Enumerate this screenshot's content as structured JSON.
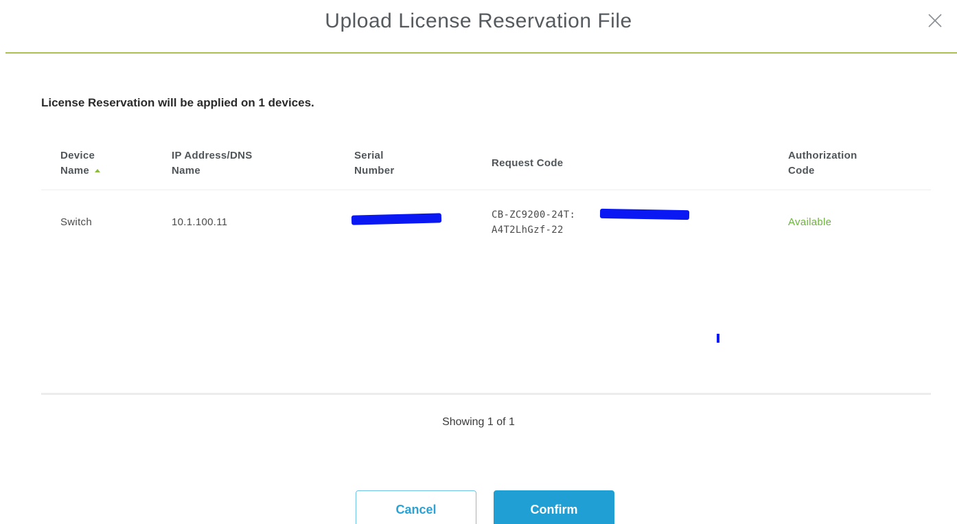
{
  "dialog": {
    "title": "Upload License Reservation File",
    "summary": "License Reservation will be applied on 1 devices."
  },
  "table": {
    "columns": {
      "device_name": [
        "Device",
        "Name"
      ],
      "ip_address": [
        "IP Address/DNS",
        "Name"
      ],
      "serial_number": [
        "Serial",
        "Number"
      ],
      "request_code": "Request Code",
      "authorization_code": [
        "Authorization",
        "Code"
      ]
    },
    "sorted_column": "Device Name",
    "sort_direction": "ascending",
    "rows": [
      {
        "device_name": "Switch",
        "ip_address": "10.1.100.11",
        "serial_number": "",
        "request_code_line1": "CB-ZC9200-24T:",
        "request_code_line2": "A4T2LhGzf-22",
        "authorization_code": "Available"
      }
    ]
  },
  "pagination": {
    "text": "Showing 1 of 1"
  },
  "buttons": {
    "cancel": "Cancel",
    "confirm": "Confirm"
  },
  "icons": {
    "close": "close-icon",
    "sort": "sort-ascending-icon"
  },
  "colors": {
    "accent_rule": "#abc04f",
    "available": "#6cb33e",
    "primary_button": "#1f9fd3",
    "redaction": "#0a19f4"
  }
}
